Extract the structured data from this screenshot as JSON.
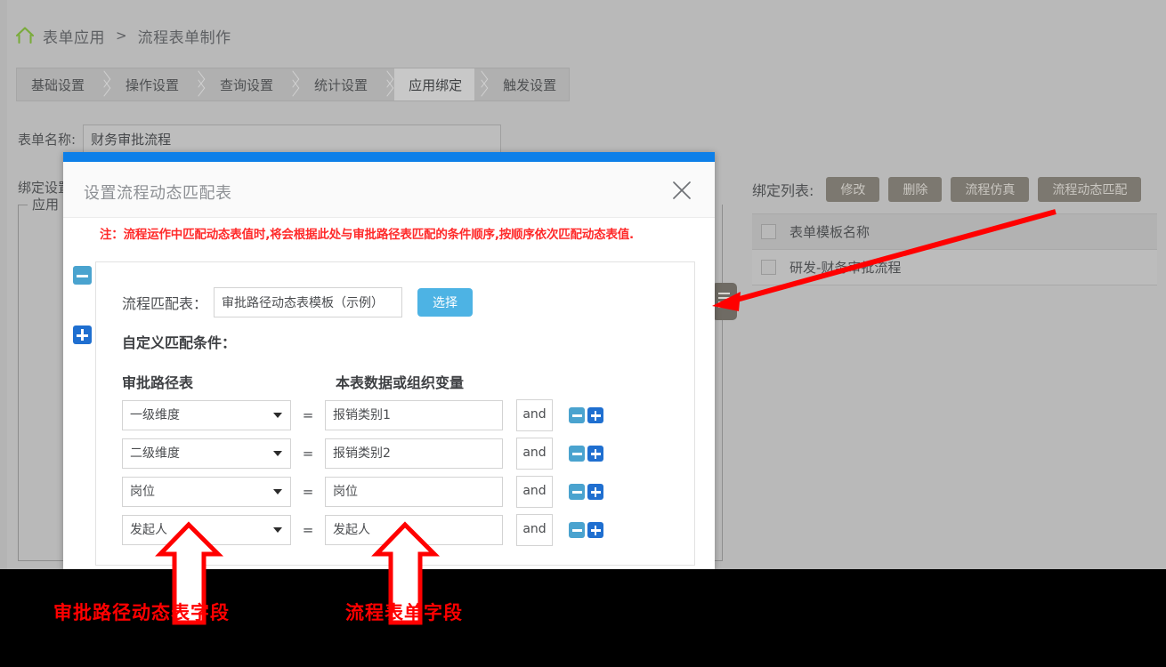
{
  "breadcrumb": {
    "home_icon": "home-icon",
    "root": "表单应用",
    "separator": ">",
    "current": "流程表单制作"
  },
  "tabs": [
    {
      "label": "基础设置",
      "active": false
    },
    {
      "label": "操作设置",
      "active": false
    },
    {
      "label": "查询设置",
      "active": false
    },
    {
      "label": "统计设置",
      "active": false
    },
    {
      "label": "应用绑定",
      "active": true
    },
    {
      "label": "触发设置",
      "active": false
    }
  ],
  "form": {
    "name_label": "表单名称:",
    "name_value": "财务审批流程",
    "bind_settings_label": "绑定设置",
    "fieldset_legend": "应用"
  },
  "side_handle": {
    "icon": "list-lines-icon"
  },
  "bind_list": {
    "title": "绑定列表:",
    "buttons": [
      "修改",
      "删除",
      "流程仿真",
      "流程动态匹配"
    ],
    "columns": [
      "表单模板名称"
    ],
    "rows": [
      [
        "研发-财务审批流程"
      ]
    ]
  },
  "modal": {
    "title": "设置流程动态匹配表",
    "close_icon": "close-icon",
    "note": "注：流程运作中匹配动态表值时,将会根据此处与审批路径表匹配的条件顺序,按顺序依次匹配动态表值.",
    "tree": [
      {
        "icon": "minus-square-icon",
        "state": "expanded"
      },
      {
        "icon": "plus-square-icon",
        "state": "collapsed"
      }
    ],
    "match_table": {
      "label": "流程匹配表：",
      "value": "审批路径动态表模板（示例）",
      "pick_button": "选择"
    },
    "custom_condition_label": "自定义匹配条件：",
    "col_headers": [
      "审批路径表",
      "本表数据或组织变量"
    ],
    "operator": "=",
    "conjunction": "and",
    "conditions": [
      {
        "left": "一级维度",
        "right": "报销类别1"
      },
      {
        "left": "二级维度",
        "right": "报销类别2"
      },
      {
        "left": "岗位",
        "right": "岗位"
      },
      {
        "left": "发起人",
        "right": "发起人"
      }
    ],
    "row_buttons": [
      "minus-square-icon",
      "plus-square-icon"
    ]
  },
  "annotations": {
    "color": "#ff0000",
    "labels": [
      {
        "text": "审批路径动态表字段"
      },
      {
        "text": "流程表单字段"
      }
    ],
    "arrows": [
      {
        "name": "arrow-to-side-handle"
      },
      {
        "name": "arrow-up-left"
      },
      {
        "name": "arrow-up-right"
      }
    ]
  },
  "colors": {
    "modal_topbar": "#0d7fe8",
    "pick_button": "#4db3e4",
    "minus_square": "#4aa3cf",
    "plus_square": "#1f6fd0",
    "note_red": "#ff2a2a",
    "annotation_red": "#ff0000",
    "home_icon_green": "#7aab3b"
  }
}
